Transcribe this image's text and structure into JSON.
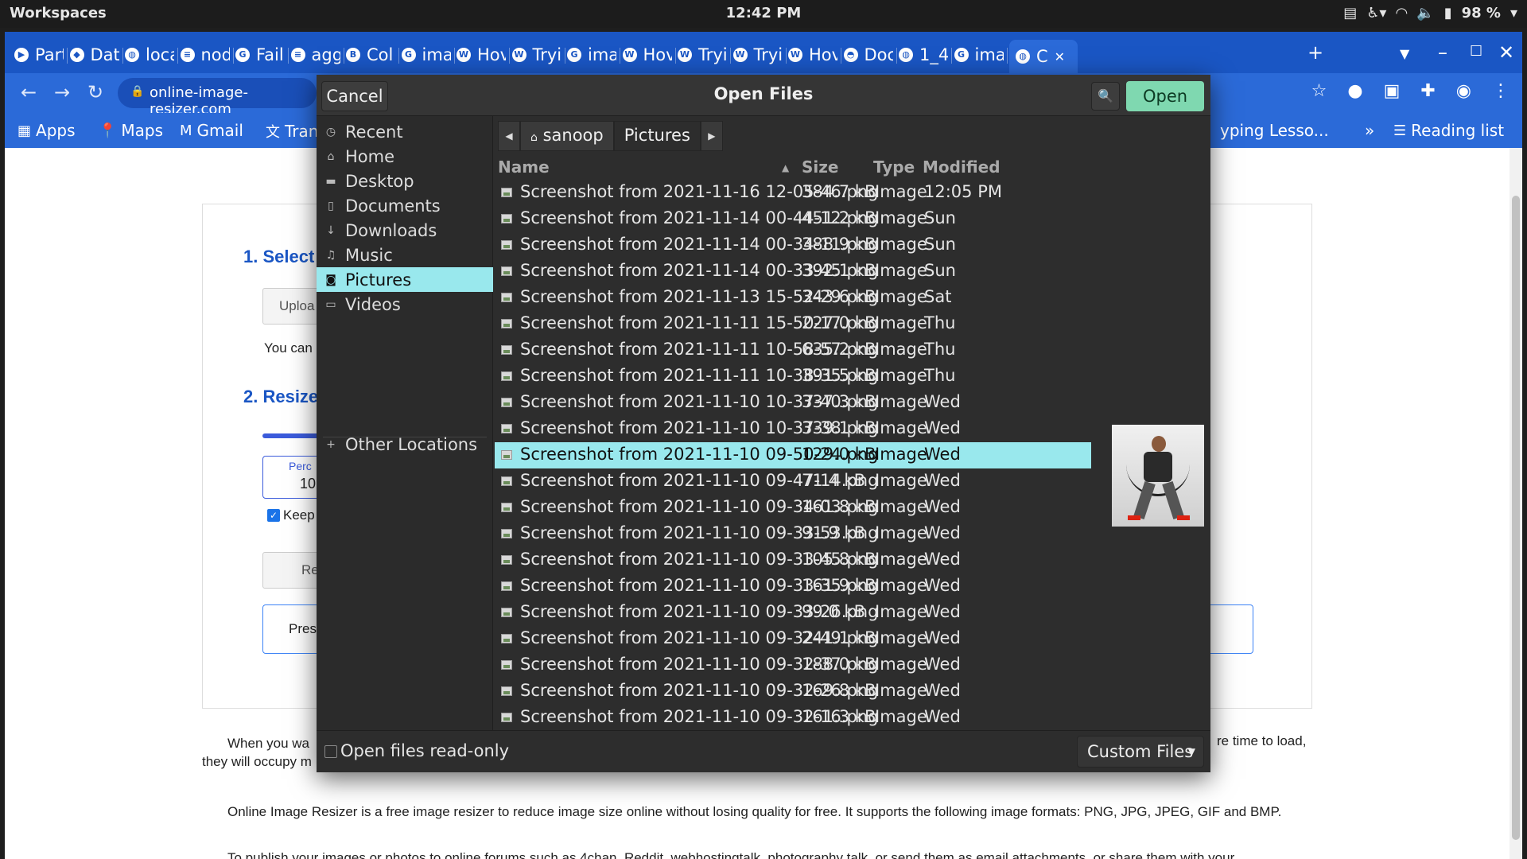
{
  "topbar": {
    "workspaces": "Workspaces",
    "clock": "12:42 PM",
    "battery": "98 %"
  },
  "browser": {
    "tabs": [
      {
        "label": "Part",
        "favicon": "youtube-icon"
      },
      {
        "label": "Dat",
        "favicon": "leaf-icon"
      },
      {
        "label": "loca",
        "favicon": "globe-icon"
      },
      {
        "label": "nod",
        "favicon": "stackoverflow-icon"
      },
      {
        "label": "Fail",
        "favicon": "google-icon"
      },
      {
        "label": "agg",
        "favicon": "stackoverflow-icon"
      },
      {
        "label": "Col",
        "favicon": "bootstrap-icon"
      },
      {
        "label": "ima",
        "favicon": "google-icon"
      },
      {
        "label": "Hov",
        "favicon": "w3schools-icon"
      },
      {
        "label": "Tryi",
        "favicon": "w3schools-icon"
      },
      {
        "label": "ima",
        "favicon": "google-icon"
      },
      {
        "label": "Hov",
        "favicon": "w3schools-icon"
      },
      {
        "label": "Tryi",
        "favicon": "w3schools-icon"
      },
      {
        "label": "Tryi",
        "favicon": "w3schools-icon"
      },
      {
        "label": "Hov",
        "favicon": "w3schools-icon"
      },
      {
        "label": "Doc",
        "favicon": "docs-icon"
      },
      {
        "label": "1_4",
        "favicon": "globe-icon"
      },
      {
        "label": "ima",
        "favicon": "google-icon"
      },
      {
        "label": "C",
        "favicon": "globe-icon"
      }
    ],
    "url": "online-image-resizer.com",
    "bookmarks": {
      "apps": "Apps",
      "maps": "Maps",
      "gmail": "Gmail",
      "translate": "Tran",
      "typing": "yping Lesso...",
      "more": "»",
      "reading_list": "Reading list"
    }
  },
  "page": {
    "step1": "1. Select",
    "upload": "Uploa",
    "you_can": "You can",
    "step2": "2. Resize",
    "percent_label": "Perc",
    "percent_value": "10",
    "keep": "Keep",
    "reset": "Re",
    "press": "Press",
    "para1_a": "When you wa",
    "para1_b": "re time to load,",
    "para1_c": "they will occupy m",
    "para2": "Online Image Resizer is a free image resizer to reduce image size online without losing quality for free. It supports the following image formats: PNG, JPG, JPEG, GIF and BMP.",
    "para3": "To publish your images or photos to online forums such as 4chan, Reddit, webhostingtalk, photography talk, or send them as email attachments, or share them with your"
  },
  "dialog": {
    "title": "Open Files",
    "cancel": "Cancel",
    "open": "Open",
    "places": [
      {
        "label": "Recent",
        "icon": "clock-icon"
      },
      {
        "label": "Home",
        "icon": "home-icon"
      },
      {
        "label": "Desktop",
        "icon": "folder-icon"
      },
      {
        "label": "Documents",
        "icon": "document-icon"
      },
      {
        "label": "Downloads",
        "icon": "download-icon"
      },
      {
        "label": "Music",
        "icon": "music-icon"
      },
      {
        "label": "Pictures",
        "icon": "camera-icon"
      },
      {
        "label": "Videos",
        "icon": "film-icon"
      }
    ],
    "other_locations": "Other Locations",
    "path": [
      "sanoop",
      "Pictures"
    ],
    "columns": {
      "name": "Name",
      "size": "Size",
      "type": "Type",
      "modified": "Modified"
    },
    "files": [
      {
        "name": "Screenshot from 2021-11-16 12-05-46.png",
        "size": "384.7 kB",
        "type": "Image",
        "modified": "12:05 PM"
      },
      {
        "name": "Screenshot from 2021-11-14 00-44-12.png",
        "size": "451.2 kB",
        "type": "Image",
        "modified": "Sun"
      },
      {
        "name": "Screenshot from 2021-11-14 00-34-11.png",
        "size": "388.9 kB",
        "type": "Image",
        "modified": "Sun"
      },
      {
        "name": "Screenshot from 2021-11-14 00-33-45.png",
        "size": "392.1 kB",
        "type": "Image",
        "modified": "Sun"
      },
      {
        "name": "Screenshot from 2021-11-13 15-52-29.png",
        "size": "343.6 kB",
        "type": "Image",
        "modified": "Sat"
      },
      {
        "name": "Screenshot from 2021-11-11 15-50-17.png",
        "size": "227.0 kB",
        "type": "Image",
        "modified": "Thu"
      },
      {
        "name": "Screenshot from 2021-11-11 10-58-57.png",
        "size": "635.2 kB",
        "type": "Image",
        "modified": "Thu"
      },
      {
        "name": "Screenshot from 2021-11-11 10-38-35.png",
        "size": "391.5 kB",
        "type": "Image",
        "modified": "Thu"
      },
      {
        "name": "Screenshot from 2021-11-10 10-37-40.png",
        "size": "337.3 kB",
        "type": "Image",
        "modified": "Wed"
      },
      {
        "name": "Screenshot from 2021-11-10 10-37-38.png",
        "size": "339.1 kB",
        "type": "Image",
        "modified": "Wed"
      },
      {
        "name": "Screenshot from 2021-11-10 09-50-24.png",
        "size": "129.0 kB",
        "type": "Image",
        "modified": "Wed"
      },
      {
        "name": "Screenshot from 2021-11-10 09-47-14.png",
        "size": "71.4 kB",
        "type": "Image",
        "modified": "Wed"
      },
      {
        "name": "Screenshot from 2021-11-10 09-34-03.png",
        "size": "161.8 kB",
        "type": "Image",
        "modified": "Wed"
      },
      {
        "name": "Screenshot from 2021-11-10 09-33-53.png",
        "size": "91.9 kB",
        "type": "Image",
        "modified": "Wed"
      },
      {
        "name": "Screenshot from 2021-11-10 09-33-45.png",
        "size": "105.8 kB",
        "type": "Image",
        "modified": "Wed"
      },
      {
        "name": "Screenshot from 2021-11-10 09-33-35.png",
        "size": "161.9 kB",
        "type": "Image",
        "modified": "Wed"
      },
      {
        "name": "Screenshot from 2021-11-10 09-33-26.png",
        "size": "99.0 kB",
        "type": "Image",
        "modified": "Wed"
      },
      {
        "name": "Screenshot from 2021-11-10 09-32-49.png",
        "size": "241.1 kB",
        "type": "Image",
        "modified": "Wed"
      },
      {
        "name": "Screenshot from 2021-11-10 09-32-37.png",
        "size": "188.0 kB",
        "type": "Image",
        "modified": "Wed"
      },
      {
        "name": "Screenshot from 2021-11-10 09-32-26.png",
        "size": "169.8 kB",
        "type": "Image",
        "modified": "Wed"
      },
      {
        "name": "Screenshot from 2021-11-10 09-32-16.png",
        "size": "161.3 kB",
        "type": "Image",
        "modified": "Wed"
      }
    ],
    "read_only_label": "Open files read-only",
    "filter": "Custom Files",
    "colors": {
      "selection": "#99e8ed",
      "open_button": "#7fd8b0"
    }
  }
}
